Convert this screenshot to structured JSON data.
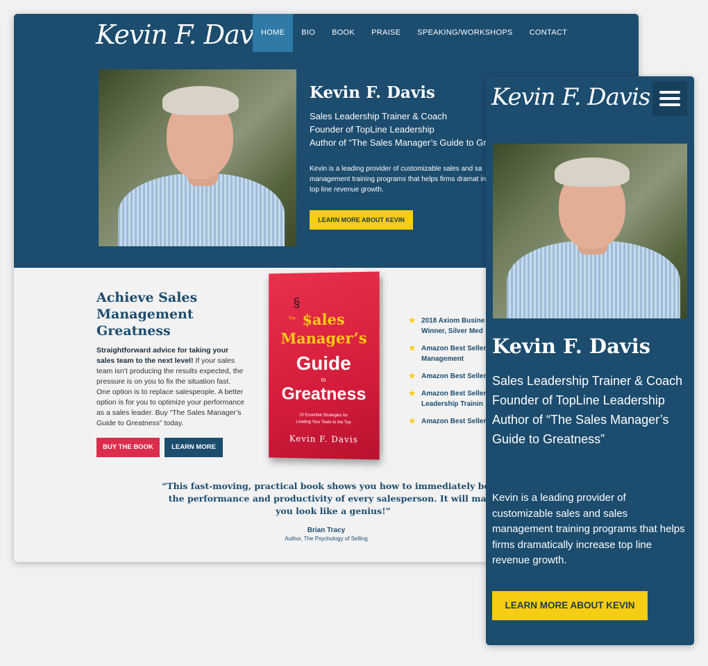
{
  "brand": {
    "logo_text": "Kevin F. Davis"
  },
  "nav": {
    "items": [
      {
        "label": "HOME",
        "active": true
      },
      {
        "label": "BIO"
      },
      {
        "label": "BOOK"
      },
      {
        "label": "PRAISE"
      },
      {
        "label": "SPEAKING/WORKSHOPS"
      },
      {
        "label": "CONTACT"
      }
    ]
  },
  "hero": {
    "name": "Kevin F. Davis",
    "subtitle_1": "Sales Leadership Trainer & Coach",
    "subtitle_2": "Founder of TopLine Leadership",
    "subtitle_3": "Author of “The Sales Manager’s Guide to Greatness”",
    "desktop_subtitle_3": "Author of “The Sales Manager’s Guide to Gre",
    "intro": "Kevin is a leading provider of customizable sales and sales management training programs that helps firms dramatically increase top line revenue growth.",
    "desktop_intro": "Kevin is a leading provider of customizable sales and sa management training programs that helps firms dramat increase top line revenue growth.",
    "cta_label": "LEARN MORE ABOUT KEVIN"
  },
  "book_section": {
    "heading": "Achieve Sales Management Greatness",
    "body_bold": "Straightforward advice for taking your sales team to the next level!",
    "body_text": " If your sales team isn’t producing the results expected, the pressure is on you to fix the situation fast. One option is to replace salespeople. A better option is for you to optimize your performance as a sales leader. Buy “The Sales Manager’s Guide to Greatness” today.",
    "buy_label": "BUY THE BOOK",
    "learn_label": "LEARN MORE"
  },
  "book_cover": {
    "the": "The",
    "line1": "$ales",
    "line2": "Manager’s",
    "line3": "Guide",
    "line4": "to",
    "line5": "Greatness",
    "tagline_1": "10 Essential Strategies for",
    "tagline_2": "Leading Your Team to the Top",
    "author": "Kevin F. Davis"
  },
  "awards": [
    {
      "line1": "2018 Axiom Busine",
      "line2": "Winner, Silver Med"
    },
    {
      "line1": "Amazon Best Seller",
      "line2": "Management"
    },
    {
      "line1": "Amazon Best Seller",
      "line2": ""
    },
    {
      "line1": "Amazon Best Seller",
      "line2": "Leadership Trainin"
    },
    {
      "line1": "Amazon Best Seller",
      "line2": ""
    }
  ],
  "quote": {
    "text": "“This fast-moving, practical book shows you how to immediately boost the performance and productivity of every salesperson. It will make you look like a genius!”",
    "author": "Brian Tracy",
    "role": "Author, The Psychology of Selling"
  },
  "colors": {
    "navy": "#1c4c6e",
    "active_nav": "#2f7aa6",
    "yellow": "#f6cd14",
    "red": "#dc2d4d",
    "page_bg": "#f1f1f1"
  },
  "icons": {
    "menu": "hamburger-menu-icon",
    "award": "star-icon"
  }
}
